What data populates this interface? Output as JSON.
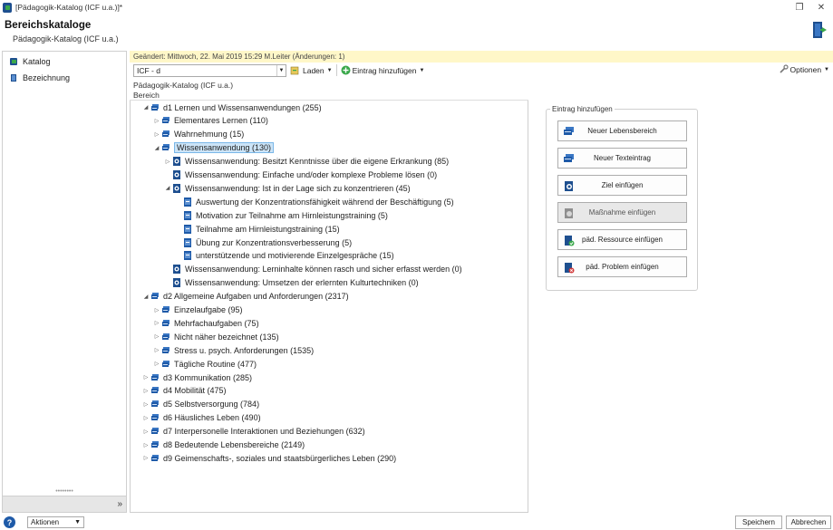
{
  "window": {
    "title": "[Pädagogik-Katalog (ICF u.a.)]*"
  },
  "header": {
    "title": "Bereichskataloge",
    "subtitle": "Pädagogik-Katalog (ICF u.a.)"
  },
  "sidebar": {
    "items": [
      {
        "label": "Katalog",
        "icon": "catalog-icon"
      },
      {
        "label": "Bezeichnung",
        "icon": "book-icon"
      }
    ],
    "collapse_label": "»"
  },
  "change_info": "Geändert: Mittwoch, 22. Mai 2019 15:29  M.Leiter  (Änderungen: 1)",
  "toolbar": {
    "filter_value": "ICF - d",
    "load_label": "Laden",
    "add_entry_label": "Eintrag hinzufügen",
    "options_label": "Optionen"
  },
  "breadcrumb": "Pädagogik-Katalog (ICF u.a.)",
  "tree_header": "Bereich",
  "tree": [
    {
      "label": "d1 Lernen und Wissensanwendungen  (255)",
      "toggle": "◢",
      "icon": "area"
    },
    {
      "label": "Elementares Lernen  (110)",
      "toggle": "▷",
      "icon": "area"
    },
    {
      "label": "Wahrnehmung  (15)",
      "toggle": "▷",
      "icon": "area"
    },
    {
      "label": "Wissensanwendung  (130)",
      "toggle": "◢",
      "icon": "area",
      "selected": true
    },
    {
      "label": "Wissensanwendung: Besitzt Kenntnisse über die eigene Erkrankung  (85)",
      "toggle": "▷",
      "icon": "goal"
    },
    {
      "label": "Wissensanwendung: Einfache und/oder komplexe Probleme lösen  (0)",
      "toggle": "",
      "icon": "goal"
    },
    {
      "label": "Wissensanwendung: Ist in der Lage sich zu konzentrieren  (45)",
      "toggle": "◢",
      "icon": "goal"
    },
    {
      "label": "Auswertung der Konzentrationsfähigkeit während der Beschäftigung  (5)",
      "toggle": "",
      "icon": "measure"
    },
    {
      "label": "Motivation zur Teilnahme am Hirnleistungstraining  (5)",
      "toggle": "",
      "icon": "measure"
    },
    {
      "label": "Teilnahme am Hirnleistungstraining  (15)",
      "toggle": "",
      "icon": "measure"
    },
    {
      "label": "Übung zur Konzentrationsverbesserung  (5)",
      "toggle": "",
      "icon": "measure"
    },
    {
      "label": "unterstützende und motivierende Einzelgespräche  (15)",
      "toggle": "",
      "icon": "measure"
    },
    {
      "label": "Wissensanwendung: Lerninhalte können rasch und sicher erfasst werden  (0)",
      "toggle": "",
      "icon": "goal"
    },
    {
      "label": "Wissensanwendung: Umsetzen der erlernten Kulturtechniken  (0)",
      "toggle": "",
      "icon": "goal"
    },
    {
      "label": "d2 Allgemeine Aufgaben und Anforderungen  (2317)",
      "toggle": "◢",
      "icon": "area"
    },
    {
      "label": "Einzelaufgabe  (95)",
      "toggle": "▷",
      "icon": "area"
    },
    {
      "label": "Mehrfachaufgaben  (75)",
      "toggle": "▷",
      "icon": "area"
    },
    {
      "label": "Nicht näher bezeichnet  (135)",
      "toggle": "▷",
      "icon": "area"
    },
    {
      "label": "Stress u. psych. Anforderungen  (1535)",
      "toggle": "▷",
      "icon": "area"
    },
    {
      "label": "Tägliche Routine  (477)",
      "toggle": "▷",
      "icon": "area"
    },
    {
      "label": "d3 Kommunikation  (285)",
      "toggle": "▷",
      "icon": "area"
    },
    {
      "label": "d4 Mobilität  (475)",
      "toggle": "▷",
      "icon": "area"
    },
    {
      "label": "d5 Selbstversorgung  (784)",
      "toggle": "▷",
      "icon": "area"
    },
    {
      "label": "d6 Häusliches Leben  (490)",
      "toggle": "▷",
      "icon": "area"
    },
    {
      "label": "d7 Interpersonelle Interaktionen und Beziehungen  (632)",
      "toggle": "▷",
      "icon": "area"
    },
    {
      "label": "d8 Bedeutende Lebensbereiche  (2149)",
      "toggle": "▷",
      "icon": "area"
    },
    {
      "label": "d9 Geimenschafts-, soziales und staatsbürgerliches Leben  (290)",
      "toggle": "▷",
      "icon": "area"
    }
  ],
  "add_panel": {
    "legend": "Eintrag hinzufügen",
    "buttons": [
      {
        "label": "Neuer Lebensbereich",
        "icon": "area-icon"
      },
      {
        "label": "Neuer Texteintrag",
        "icon": "text-entry-icon"
      },
      {
        "label": "Ziel einfügen",
        "icon": "goal-icon"
      },
      {
        "label": "Maßnahme einfügen",
        "icon": "measure-icon",
        "disabled": true
      },
      {
        "label": "päd. Ressource einfügen",
        "icon": "resource-icon"
      },
      {
        "label": "päd. Problem einfügen",
        "icon": "problem-icon"
      }
    ]
  },
  "statusbar": {
    "help_label": "?",
    "actions_label": "Aktionen",
    "save_label": "Speichern",
    "cancel_label": "Abbrechen"
  },
  "colors": {
    "accent_blue": "#1e5aa8",
    "selection": "#cce4f7",
    "change_bar": "#fff7c8",
    "green": "#3aa84b",
    "red": "#d23a3a"
  }
}
